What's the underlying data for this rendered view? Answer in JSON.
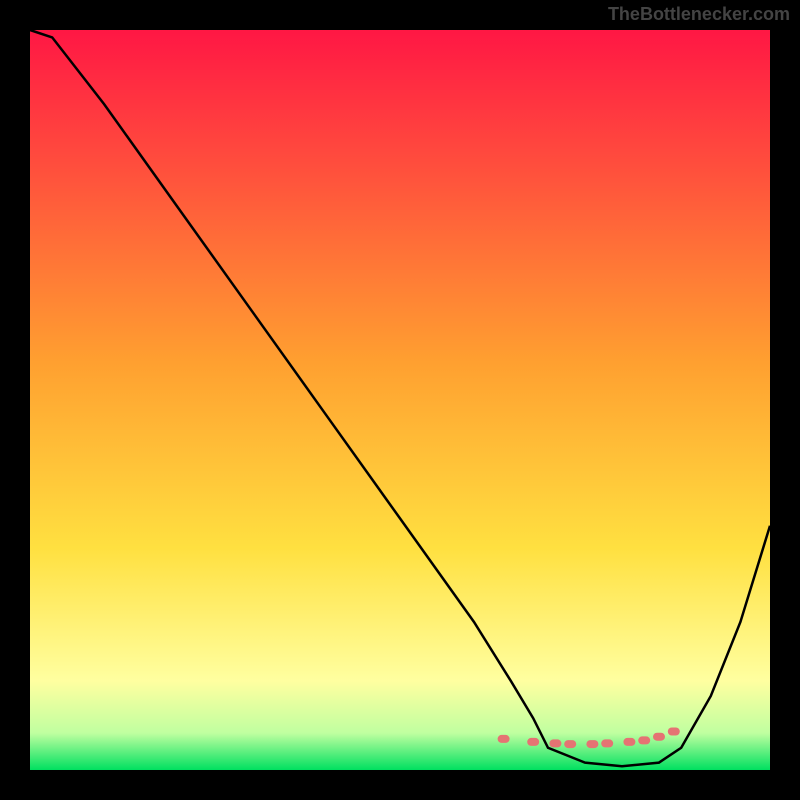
{
  "watermark": "TheBottlenecker.com",
  "chart_data": {
    "type": "line",
    "title": "",
    "xlabel": "",
    "ylabel": "",
    "xlim": [
      0,
      100
    ],
    "ylim": [
      0,
      100
    ],
    "series": [
      {
        "name": "curve",
        "x": [
          0,
          3,
          10,
          20,
          30,
          40,
          50,
          60,
          65,
          68,
          70,
          75,
          80,
          85,
          88,
          92,
          96,
          100
        ],
        "y": [
          100,
          99,
          90,
          76,
          62,
          48,
          34,
          20,
          12,
          7,
          3,
          1,
          0.5,
          1,
          3,
          10,
          20,
          33
        ]
      }
    ],
    "highlight_points": {
      "name": "red-dots",
      "x": [
        64,
        68,
        71,
        73,
        76,
        78,
        81,
        83,
        85,
        87
      ],
      "y": [
        4.2,
        3.8,
        3.6,
        3.5,
        3.5,
        3.6,
        3.8,
        4.0,
        4.5,
        5.2
      ]
    },
    "gradient_colors": {
      "top": "#ff1744",
      "mid_red": "#ff4d3d",
      "mid_orange": "#ffa030",
      "mid_yellow": "#ffe040",
      "light_yellow": "#ffffa0",
      "pale_green": "#c0ffa0",
      "green": "#00e060"
    },
    "dot_color": "#e57373"
  }
}
